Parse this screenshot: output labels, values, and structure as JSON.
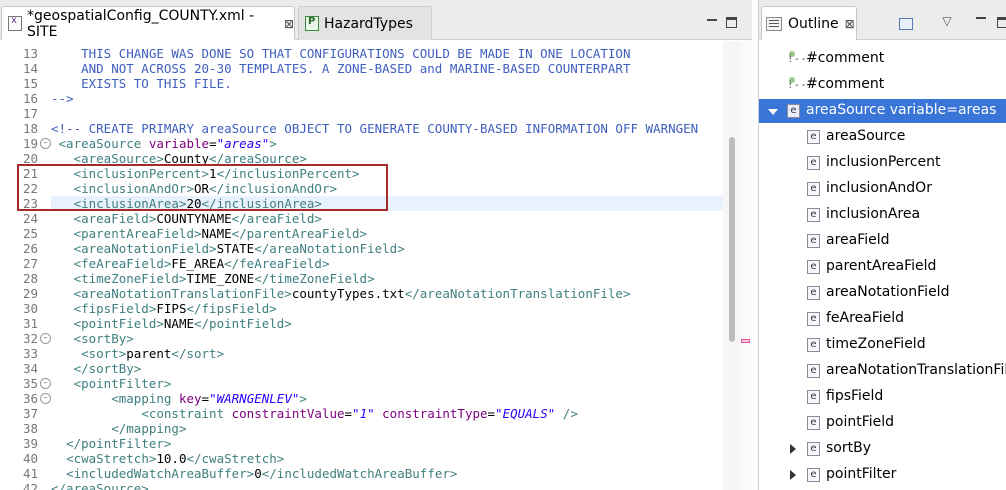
{
  "editor": {
    "tabs": [
      {
        "label": "*geospatialConfig_COUNTY.xml - SITE",
        "icon": "xml-file-icon",
        "active": true
      },
      {
        "label": "HazardTypes",
        "icon": "python-file-icon",
        "active": false
      }
    ],
    "close_glyph": "⊠",
    "lines": [
      {
        "n": "13",
        "parts": [
          {
            "c": "com",
            "t": "    THIS CHANGE WAS DONE SO THAT CONFIGURATIONS COULD BE MADE IN ONE LOCATION"
          }
        ]
      },
      {
        "n": "14",
        "parts": [
          {
            "c": "com",
            "t": "    AND NOT ACROSS 20-30 TEMPLATES. A ZONE-BASED and MARINE-BASED COUNTERPART"
          }
        ]
      },
      {
        "n": "15",
        "parts": [
          {
            "c": "com",
            "t": "    EXISTS TO THIS FILE."
          }
        ]
      },
      {
        "n": "16",
        "parts": [
          {
            "c": "com",
            "t": "-->"
          }
        ]
      },
      {
        "n": "17",
        "parts": []
      },
      {
        "n": "18",
        "parts": [
          {
            "c": "com",
            "t": "<!-- CREATE PRIMARY areaSource OBJECT TO GENERATE COUNTY-BASED INFORMATION OFF WARNGEN"
          }
        ]
      },
      {
        "n": "19",
        "fold": true,
        "parts": [
          {
            "c": "txt",
            "t": " "
          },
          {
            "c": "tag",
            "t": "<areaSource "
          },
          {
            "c": "attr",
            "t": "variable"
          },
          {
            "c": "txt",
            "t": "="
          },
          {
            "c": "val",
            "t": "\"areas\""
          },
          {
            "c": "tag",
            "t": ">"
          }
        ]
      },
      {
        "n": "20",
        "parts": [
          {
            "c": "txt",
            "t": "   "
          },
          {
            "c": "tag",
            "t": "<areaSource>"
          },
          {
            "c": "txt",
            "t": "County"
          },
          {
            "c": "tag",
            "t": "</areaSource>"
          }
        ]
      },
      {
        "n": "21",
        "parts": [
          {
            "c": "txt",
            "t": "   "
          },
          {
            "c": "tag",
            "t": "<inclusionPercent>"
          },
          {
            "c": "txt",
            "t": "1"
          },
          {
            "c": "tag",
            "t": "</inclusionPercent>"
          }
        ]
      },
      {
        "n": "22",
        "parts": [
          {
            "c": "txt",
            "t": "   "
          },
          {
            "c": "tag",
            "t": "<inclusionAndOr>"
          },
          {
            "c": "txt",
            "t": "OR"
          },
          {
            "c": "tag",
            "t": "</inclusionAndOr>"
          }
        ]
      },
      {
        "n": "23",
        "current": true,
        "parts": [
          {
            "c": "txt",
            "t": "   "
          },
          {
            "c": "tag",
            "t": "<inclusionArea>"
          },
          {
            "c": "txt",
            "t": "20"
          },
          {
            "c": "tag",
            "t": "</inclusionArea>"
          }
        ]
      },
      {
        "n": "24",
        "parts": [
          {
            "c": "txt",
            "t": "   "
          },
          {
            "c": "tag",
            "t": "<areaField>"
          },
          {
            "c": "txt",
            "t": "COUNTYNAME"
          },
          {
            "c": "tag",
            "t": "</areaField>"
          }
        ]
      },
      {
        "n": "25",
        "parts": [
          {
            "c": "txt",
            "t": "   "
          },
          {
            "c": "tag",
            "t": "<parentAreaField>"
          },
          {
            "c": "txt",
            "t": "NAME"
          },
          {
            "c": "tag",
            "t": "</parentAreaField>"
          }
        ]
      },
      {
        "n": "26",
        "parts": [
          {
            "c": "txt",
            "t": "   "
          },
          {
            "c": "tag",
            "t": "<areaNotationField>"
          },
          {
            "c": "txt",
            "t": "STATE"
          },
          {
            "c": "tag",
            "t": "</areaNotationField>"
          }
        ]
      },
      {
        "n": "27",
        "parts": [
          {
            "c": "txt",
            "t": "   "
          },
          {
            "c": "tag",
            "t": "<feAreaField>"
          },
          {
            "c": "txt",
            "t": "FE_AREA"
          },
          {
            "c": "tag",
            "t": "</feAreaField>"
          }
        ]
      },
      {
        "n": "28",
        "parts": [
          {
            "c": "txt",
            "t": "   "
          },
          {
            "c": "tag",
            "t": "<timeZoneField>"
          },
          {
            "c": "txt",
            "t": "TIME_ZONE"
          },
          {
            "c": "tag",
            "t": "</timeZoneField>"
          }
        ]
      },
      {
        "n": "29",
        "parts": [
          {
            "c": "txt",
            "t": "   "
          },
          {
            "c": "tag",
            "t": "<areaNotationTranslationFile>"
          },
          {
            "c": "txt",
            "t": "countyTypes.txt"
          },
          {
            "c": "tag",
            "t": "</areaNotationTranslationFile>"
          }
        ]
      },
      {
        "n": "30",
        "parts": [
          {
            "c": "txt",
            "t": "   "
          },
          {
            "c": "tag",
            "t": "<fipsField>"
          },
          {
            "c": "txt",
            "t": "FIPS"
          },
          {
            "c": "tag",
            "t": "</fipsField>"
          }
        ]
      },
      {
        "n": "31",
        "parts": [
          {
            "c": "txt",
            "t": "   "
          },
          {
            "c": "tag",
            "t": "<pointField>"
          },
          {
            "c": "txt",
            "t": "NAME"
          },
          {
            "c": "tag",
            "t": "</pointField>"
          }
        ]
      },
      {
        "n": "32",
        "fold": true,
        "parts": [
          {
            "c": "txt",
            "t": "   "
          },
          {
            "c": "tag",
            "t": "<sortBy>"
          }
        ]
      },
      {
        "n": "33",
        "parts": [
          {
            "c": "txt",
            "t": "    "
          },
          {
            "c": "tag",
            "t": "<sort>"
          },
          {
            "c": "txt",
            "t": "parent"
          },
          {
            "c": "tag",
            "t": "</sort>"
          }
        ]
      },
      {
        "n": "34",
        "parts": [
          {
            "c": "txt",
            "t": "   "
          },
          {
            "c": "tag",
            "t": "</sortBy>"
          }
        ]
      },
      {
        "n": "35",
        "fold": true,
        "parts": [
          {
            "c": "txt",
            "t": "   "
          },
          {
            "c": "tag",
            "t": "<pointFilter>"
          }
        ]
      },
      {
        "n": "36",
        "fold": true,
        "parts": [
          {
            "c": "txt",
            "t": "        "
          },
          {
            "c": "tag",
            "t": "<mapping "
          },
          {
            "c": "attr",
            "t": "key"
          },
          {
            "c": "txt",
            "t": "="
          },
          {
            "c": "val",
            "t": "\"WARNGENLEV\""
          },
          {
            "c": "tag",
            "t": ">"
          }
        ]
      },
      {
        "n": "37",
        "parts": [
          {
            "c": "txt",
            "t": "            "
          },
          {
            "c": "tag",
            "t": "<constraint "
          },
          {
            "c": "attr",
            "t": "constraintValue"
          },
          {
            "c": "txt",
            "t": "="
          },
          {
            "c": "val",
            "t": "\"1\""
          },
          {
            "c": "txt",
            "t": " "
          },
          {
            "c": "attr",
            "t": "constraintType"
          },
          {
            "c": "txt",
            "t": "="
          },
          {
            "c": "val",
            "t": "\"EQUALS\""
          },
          {
            "c": "txt",
            "t": " "
          },
          {
            "c": "tag",
            "t": "/>"
          }
        ]
      },
      {
        "n": "38",
        "parts": [
          {
            "c": "txt",
            "t": "        "
          },
          {
            "c": "tag",
            "t": "</mapping>"
          }
        ]
      },
      {
        "n": "39",
        "parts": [
          {
            "c": "txt",
            "t": "  "
          },
          {
            "c": "tag",
            "t": "</pointFilter>"
          }
        ]
      },
      {
        "n": "40",
        "parts": [
          {
            "c": "txt",
            "t": "  "
          },
          {
            "c": "tag",
            "t": "<cwaStretch>"
          },
          {
            "c": "txt",
            "t": "10.0"
          },
          {
            "c": "tag",
            "t": "</cwaStretch>"
          }
        ]
      },
      {
        "n": "41",
        "parts": [
          {
            "c": "txt",
            "t": "  "
          },
          {
            "c": "tag",
            "t": "<includedWatchAreaBuffer>"
          },
          {
            "c": "txt",
            "t": "0"
          },
          {
            "c": "tag",
            "t": "</includedWatchAreaBuffer>"
          }
        ]
      },
      {
        "n": "42",
        "parts": [
          {
            "c": "tag",
            "t": "</areaSource>"
          }
        ]
      }
    ]
  },
  "outline": {
    "title": "Outline",
    "close_glyph": "⊠",
    "nodes": [
      {
        "label": "#comment",
        "kind": "comment",
        "depth": 0,
        "twisty": "none"
      },
      {
        "label": "#comment",
        "kind": "comment",
        "depth": 0,
        "twisty": "none"
      },
      {
        "label": "areaSource variable=areas",
        "kind": "element",
        "depth": 0,
        "twisty": "open",
        "selected": true
      },
      {
        "label": "areaSource",
        "kind": "element",
        "depth": 1,
        "twisty": "none"
      },
      {
        "label": "inclusionPercent",
        "kind": "element",
        "depth": 1,
        "twisty": "none"
      },
      {
        "label": "inclusionAndOr",
        "kind": "element",
        "depth": 1,
        "twisty": "none"
      },
      {
        "label": "inclusionArea",
        "kind": "element",
        "depth": 1,
        "twisty": "none"
      },
      {
        "label": "areaField",
        "kind": "element",
        "depth": 1,
        "twisty": "none"
      },
      {
        "label": "parentAreaField",
        "kind": "element",
        "depth": 1,
        "twisty": "none"
      },
      {
        "label": "areaNotationField",
        "kind": "element",
        "depth": 1,
        "twisty": "none"
      },
      {
        "label": "feAreaField",
        "kind": "element",
        "depth": 1,
        "twisty": "none"
      },
      {
        "label": "timeZoneField",
        "kind": "element",
        "depth": 1,
        "twisty": "none"
      },
      {
        "label": "areaNotationTranslationFile",
        "kind": "element",
        "depth": 1,
        "twisty": "none"
      },
      {
        "label": "fipsField",
        "kind": "element",
        "depth": 1,
        "twisty": "none"
      },
      {
        "label": "pointField",
        "kind": "element",
        "depth": 1,
        "twisty": "none"
      },
      {
        "label": "sortBy",
        "kind": "element",
        "depth": 1,
        "twisty": "closed"
      },
      {
        "label": "pointFilter",
        "kind": "element",
        "depth": 1,
        "twisty": "closed"
      }
    ]
  },
  "colors": {
    "comment": "#3f5fbf",
    "tag": "#3f7f7f",
    "attribute": "#7f007f",
    "attribute_value": "#2a00ff",
    "selection": "#3875d7",
    "highlight_box": "#a52a2a"
  }
}
